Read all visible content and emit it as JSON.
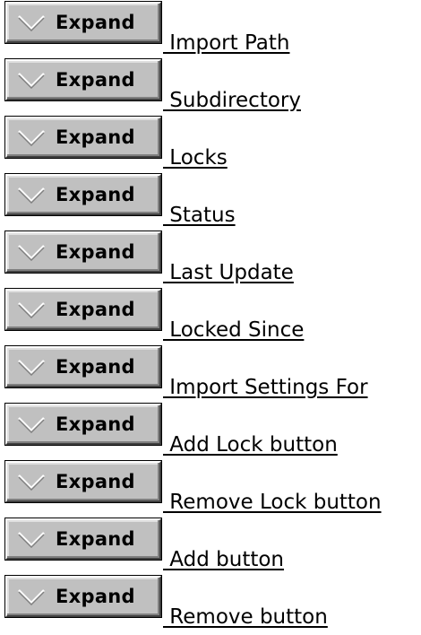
{
  "expand_label": "Expand",
  "icon": "chevron-down-icon",
  "items": [
    {
      "label": " Import Path"
    },
    {
      "label": " Subdirectory"
    },
    {
      "label": " Locks"
    },
    {
      "label": " Status"
    },
    {
      "label": " Last Update"
    },
    {
      "label": " Locked Since"
    },
    {
      "label": " Import Settings For"
    },
    {
      "label": " Add Lock button"
    },
    {
      "label": " Remove Lock button"
    },
    {
      "label": " Add button"
    },
    {
      "label": " Remove button"
    }
  ]
}
